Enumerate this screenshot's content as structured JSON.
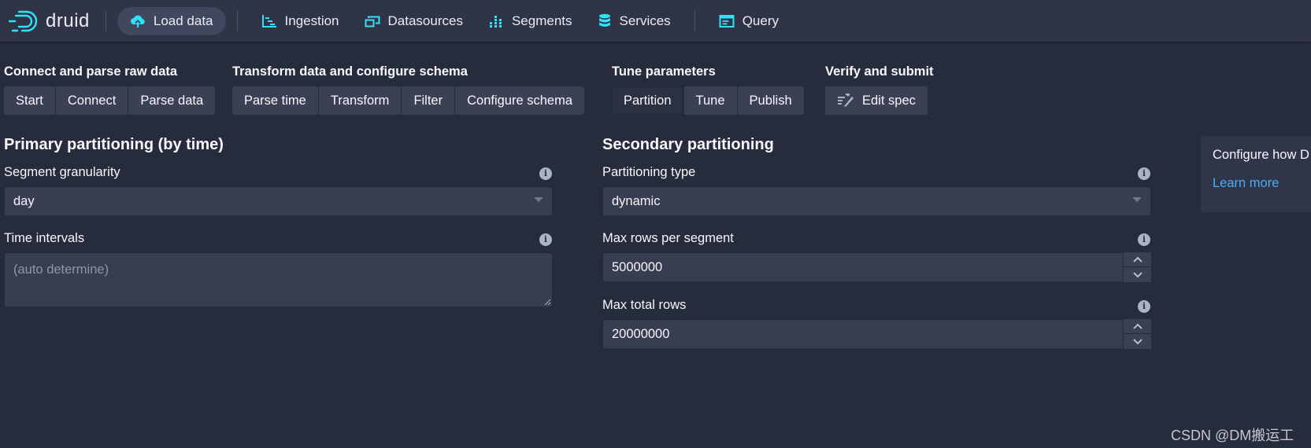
{
  "app": {
    "logo_text": "druid",
    "accent_color": "#2ee2fa"
  },
  "nav": {
    "load_data": "Load data",
    "ingestion": "Ingestion",
    "datasources": "Datasources",
    "segments": "Segments",
    "services": "Services",
    "query": "Query"
  },
  "steps": {
    "connect_group": {
      "title": "Connect and parse raw data",
      "buttons": [
        "Start",
        "Connect",
        "Parse data"
      ]
    },
    "transform_group": {
      "title": "Transform data and configure schema",
      "buttons": [
        "Parse time",
        "Transform",
        "Filter",
        "Configure schema"
      ]
    },
    "tune_group": {
      "title": "Tune parameters",
      "buttons": [
        "Partition",
        "Tune",
        "Publish"
      ],
      "active": "Partition"
    },
    "verify_group": {
      "title": "Verify and submit",
      "buttons": [
        "Edit spec"
      ]
    }
  },
  "primary": {
    "title": "Primary partitioning (by time)",
    "segment_granularity_label": "Segment granularity",
    "segment_granularity_value": "day",
    "time_intervals_label": "Time intervals",
    "time_intervals_placeholder": "(auto determine)"
  },
  "secondary": {
    "title": "Secondary partitioning",
    "partitioning_type_label": "Partitioning type",
    "partitioning_type_value": "dynamic",
    "max_rows_per_segment_label": "Max rows per segment",
    "max_rows_per_segment_value": "5000000",
    "max_total_rows_label": "Max total rows",
    "max_total_rows_value": "20000000"
  },
  "side_panel": {
    "text": "Configure how D",
    "link": "Learn more"
  },
  "watermark": "CSDN @DM搬运工"
}
